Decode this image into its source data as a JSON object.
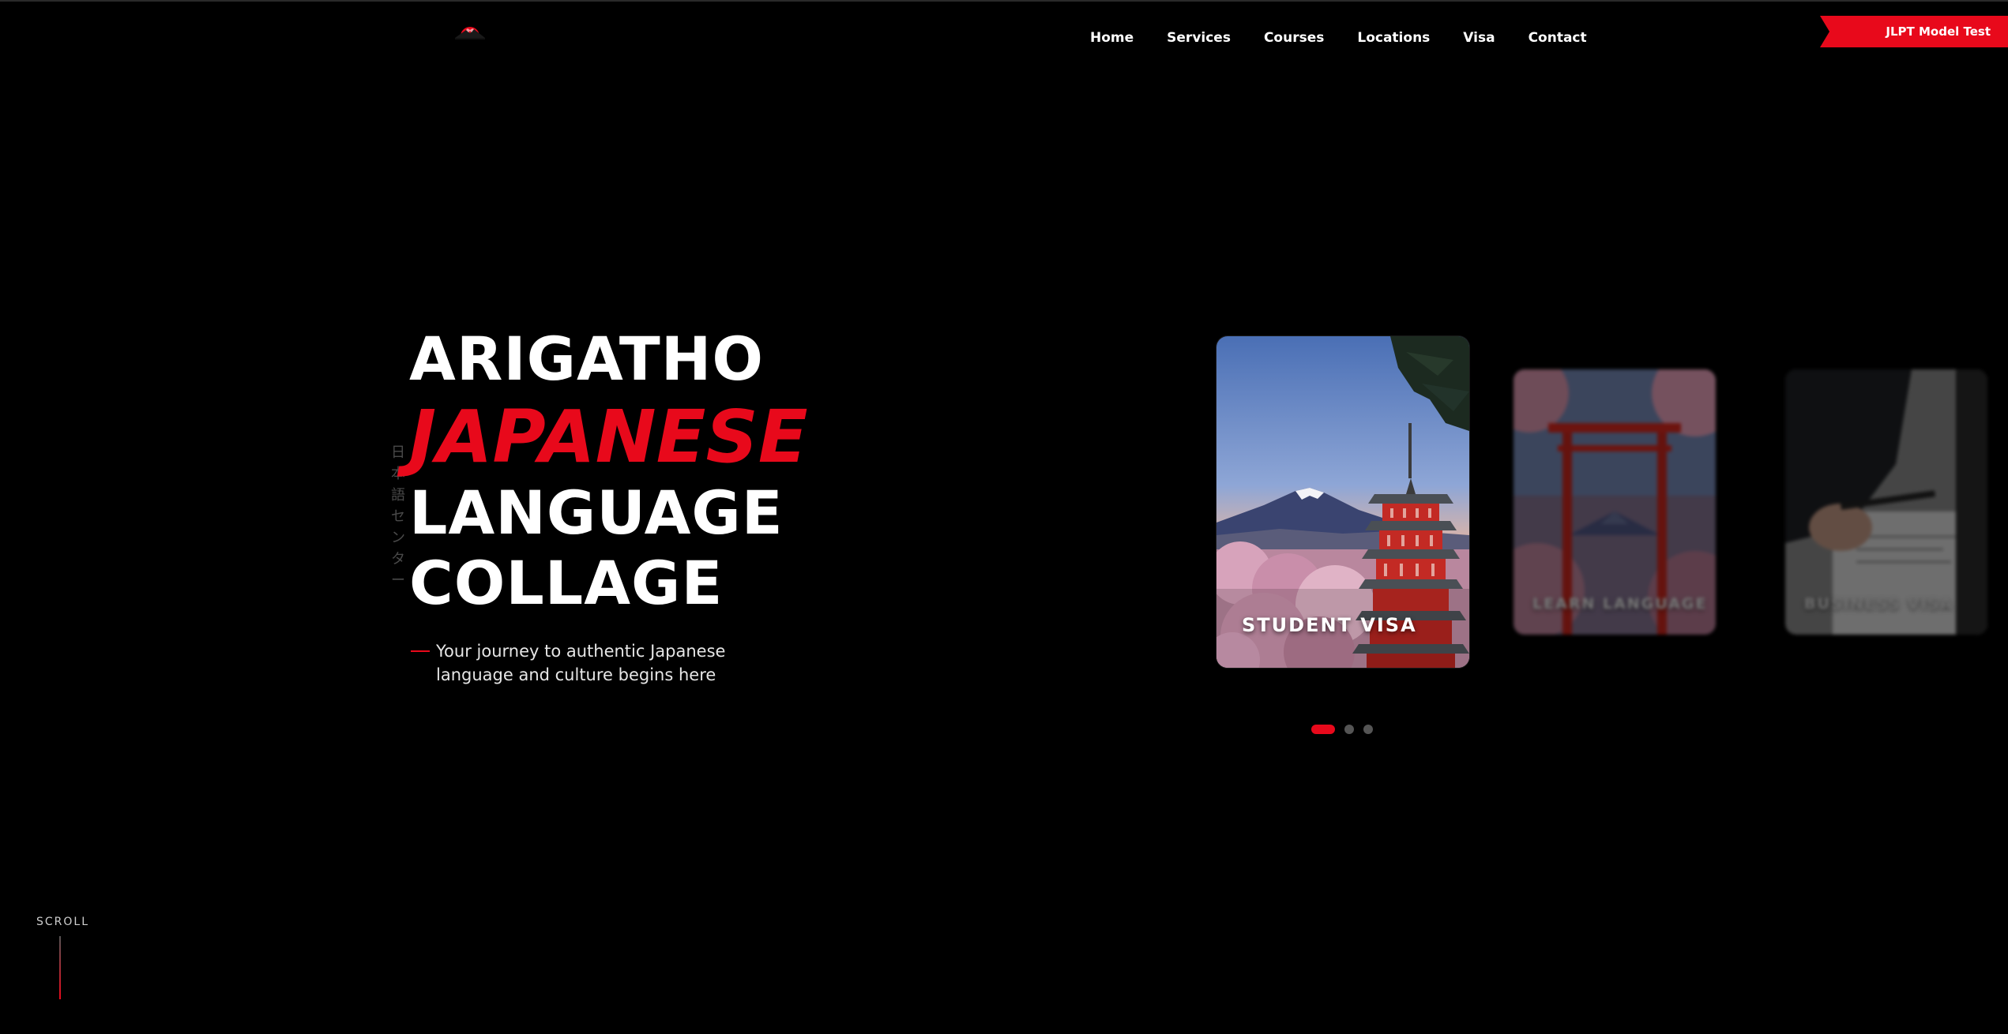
{
  "header": {
    "logo_icon": "red-sun-mountain-logo",
    "nav": [
      {
        "label": "Home"
      },
      {
        "label": "Services"
      },
      {
        "label": "Courses"
      },
      {
        "label": "Locations"
      },
      {
        "label": "Visa"
      },
      {
        "label": "Contact"
      }
    ],
    "cta_label": "JLPT Model Test Workshop"
  },
  "hero": {
    "vertical_text": "日本語センター",
    "title_lines": [
      "ARIGATHO",
      "JAPANESE",
      "LANGUAGE",
      "COLLAGE"
    ],
    "subtitle": "Your journey to authentic Japanese language and culture begins here"
  },
  "carousel": {
    "cards": [
      {
        "label": "STUDENT VISA",
        "image": "mount-fuji-pagoda-cherry-blossom",
        "active": true
      },
      {
        "label": "LEARN LANGUAGE",
        "image": "torii-gate-mount-fuji",
        "active": false
      },
      {
        "label": "BUSINESS VISA",
        "image": "business-person-signing-document",
        "active": false
      }
    ],
    "active_index": 0,
    "dot_count": 3
  },
  "scroll": {
    "label": "SCROLL"
  },
  "colors": {
    "accent": "#e8091b",
    "background": "#000000",
    "text": "#ffffff"
  }
}
